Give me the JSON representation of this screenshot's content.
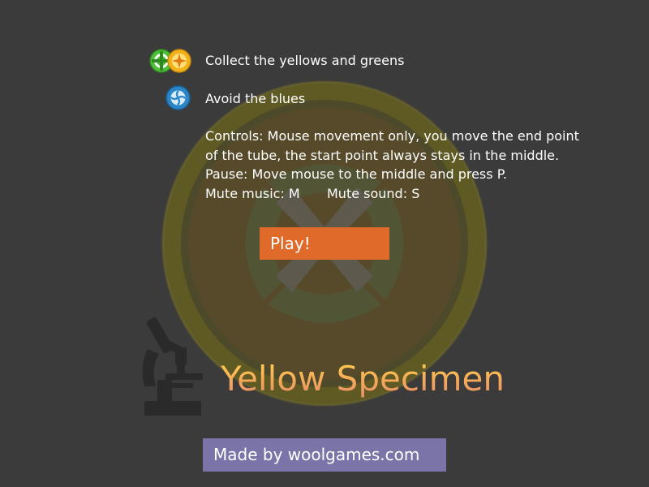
{
  "instructions": {
    "collect_text": "Collect the yellows and greens",
    "avoid_text": "Avoid the blues",
    "controls_line1": "Controls: Mouse movement only, you move the end point",
    "controls_line2": "of the tube, the start point always stays in the middle.",
    "pause_text": "Pause: Move mouse to the middle and press P.",
    "mute_music": "Mute music: M",
    "mute_sound": "Mute sound: S"
  },
  "play_button": {
    "label": "Play!"
  },
  "title": "Yellow Specimen",
  "credit": {
    "label": "Made by woolgames.com"
  },
  "icons": {
    "green_specimen": "green-specimen-icon",
    "yellow_specimen": "yellow-specimen-icon",
    "blue_specimen": "blue-specimen-icon",
    "microscope": "microscope-icon",
    "petri_dish": "petri-dish-background"
  },
  "colors": {
    "background": "#3b3b3b",
    "play_button": "#e06a2a",
    "credit_button": "#7a74a8",
    "title_top": "#ffd34a",
    "title_bottom": "#e58c6a",
    "green_specimen": "#4fbf3a",
    "yellow_specimen": "#f2b31a",
    "blue_specimen": "#2a86c8"
  }
}
